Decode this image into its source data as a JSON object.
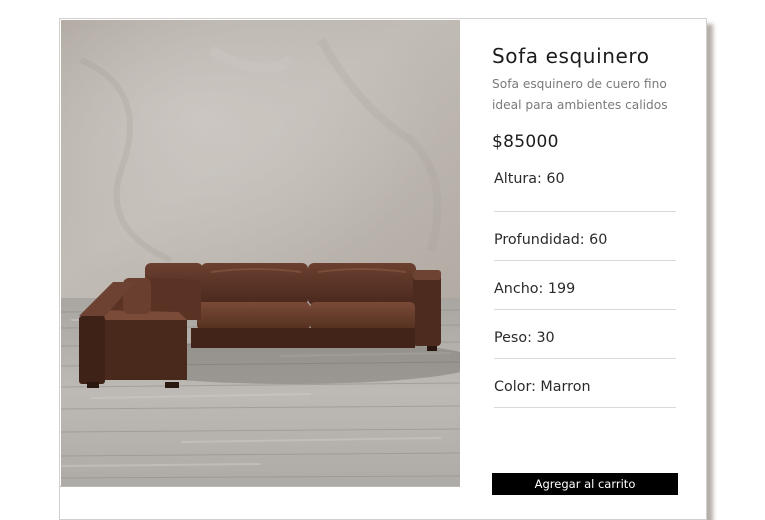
{
  "product": {
    "image_alt": "sofa-esquinero-photo",
    "title": "Sofa esquinero",
    "description": "Sofa esquinero de cuero fino ideal para ambientes calidos",
    "price": "$85000",
    "specs": [
      {
        "label": "Altura: 60"
      },
      {
        "label": "Profundidad: 60"
      },
      {
        "label": "Ancho: 199"
      },
      {
        "label": "Peso: 30"
      },
      {
        "label": "Color: Marron"
      }
    ],
    "cart_button_label": "Agregar al carrito"
  },
  "colors": {
    "button_bg": "#000000",
    "button_text": "#ffffff",
    "leather": "#5a3426",
    "wall": "#b9b2ab",
    "floor": "#b3b0aa"
  }
}
